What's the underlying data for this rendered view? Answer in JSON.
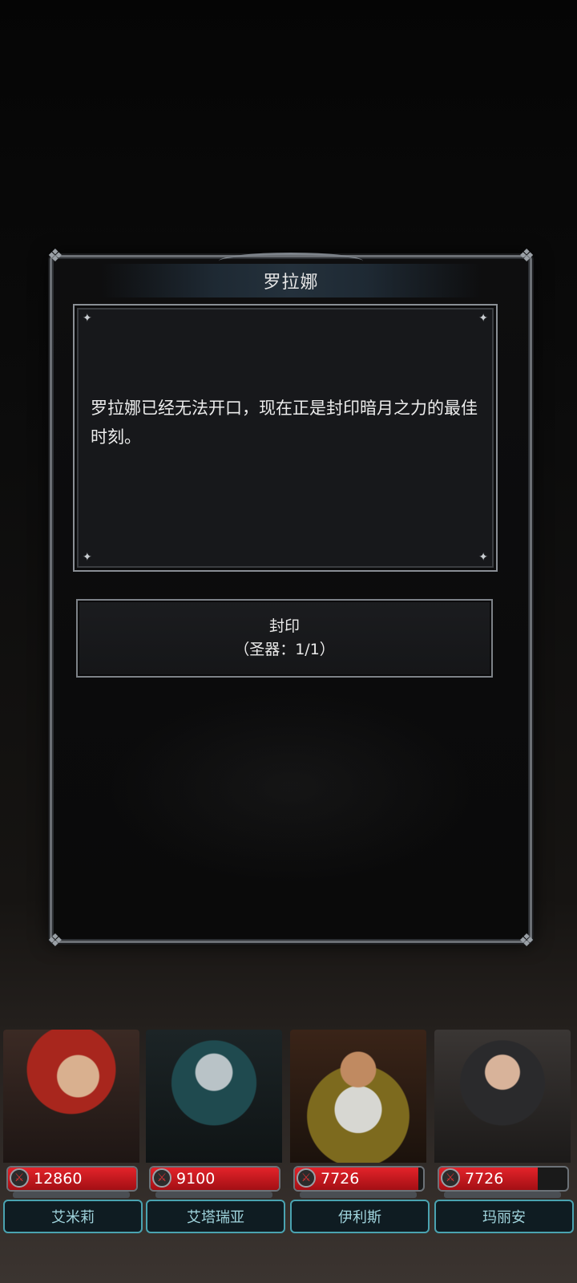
{
  "dialog": {
    "title": "罗拉娜",
    "message": "罗拉娜已经无法开口，现在正是封印暗月之力的最佳时刻。",
    "action": {
      "label": "封印",
      "detail": "（圣器：1/1）"
    }
  },
  "party": [
    {
      "name": "艾米莉",
      "hp": "12860",
      "hp_fraction": 1.0
    },
    {
      "name": "艾塔瑞亚",
      "hp": "9100",
      "hp_fraction": 1.0
    },
    {
      "name": "伊利斯",
      "hp": "7726",
      "hp_fraction": 0.96
    },
    {
      "name": "玛丽安",
      "hp": "7726",
      "hp_fraction": 0.77
    }
  ],
  "colors": {
    "hp": "#e3232a",
    "name_accent": "#4aa3b1"
  }
}
